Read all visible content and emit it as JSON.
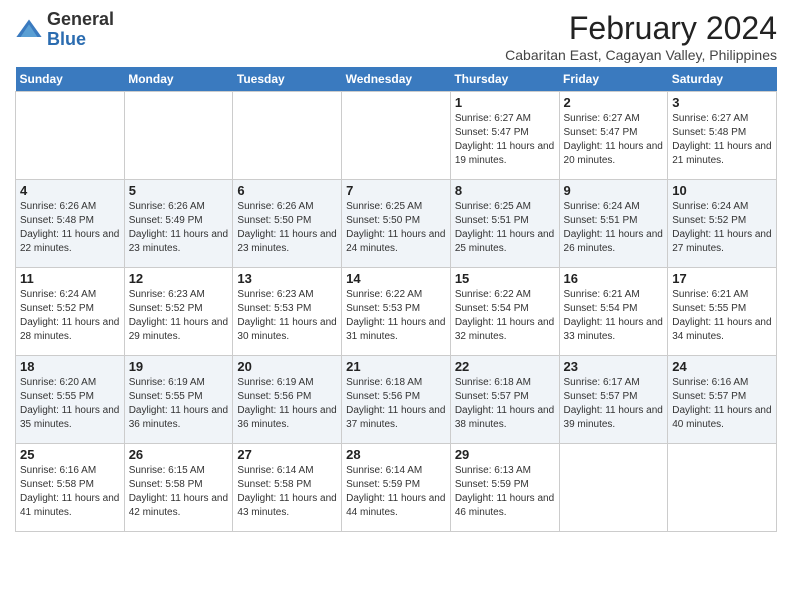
{
  "header": {
    "logo_general": "General",
    "logo_blue": "Blue",
    "month_title": "February 2024",
    "subtitle": "Cabaritan East, Cagayan Valley, Philippines"
  },
  "days_of_week": [
    "Sunday",
    "Monday",
    "Tuesday",
    "Wednesday",
    "Thursday",
    "Friday",
    "Saturday"
  ],
  "weeks": [
    [
      {
        "day": "",
        "info": ""
      },
      {
        "day": "",
        "info": ""
      },
      {
        "day": "",
        "info": ""
      },
      {
        "day": "",
        "info": ""
      },
      {
        "day": "1",
        "info": "Sunrise: 6:27 AM\nSunset: 5:47 PM\nDaylight: 11 hours and 19 minutes."
      },
      {
        "day": "2",
        "info": "Sunrise: 6:27 AM\nSunset: 5:47 PM\nDaylight: 11 hours and 20 minutes."
      },
      {
        "day": "3",
        "info": "Sunrise: 6:27 AM\nSunset: 5:48 PM\nDaylight: 11 hours and 21 minutes."
      }
    ],
    [
      {
        "day": "4",
        "info": "Sunrise: 6:26 AM\nSunset: 5:48 PM\nDaylight: 11 hours and 22 minutes."
      },
      {
        "day": "5",
        "info": "Sunrise: 6:26 AM\nSunset: 5:49 PM\nDaylight: 11 hours and 23 minutes."
      },
      {
        "day": "6",
        "info": "Sunrise: 6:26 AM\nSunset: 5:50 PM\nDaylight: 11 hours and 23 minutes."
      },
      {
        "day": "7",
        "info": "Sunrise: 6:25 AM\nSunset: 5:50 PM\nDaylight: 11 hours and 24 minutes."
      },
      {
        "day": "8",
        "info": "Sunrise: 6:25 AM\nSunset: 5:51 PM\nDaylight: 11 hours and 25 minutes."
      },
      {
        "day": "9",
        "info": "Sunrise: 6:24 AM\nSunset: 5:51 PM\nDaylight: 11 hours and 26 minutes."
      },
      {
        "day": "10",
        "info": "Sunrise: 6:24 AM\nSunset: 5:52 PM\nDaylight: 11 hours and 27 minutes."
      }
    ],
    [
      {
        "day": "11",
        "info": "Sunrise: 6:24 AM\nSunset: 5:52 PM\nDaylight: 11 hours and 28 minutes."
      },
      {
        "day": "12",
        "info": "Sunrise: 6:23 AM\nSunset: 5:52 PM\nDaylight: 11 hours and 29 minutes."
      },
      {
        "day": "13",
        "info": "Sunrise: 6:23 AM\nSunset: 5:53 PM\nDaylight: 11 hours and 30 minutes."
      },
      {
        "day": "14",
        "info": "Sunrise: 6:22 AM\nSunset: 5:53 PM\nDaylight: 11 hours and 31 minutes."
      },
      {
        "day": "15",
        "info": "Sunrise: 6:22 AM\nSunset: 5:54 PM\nDaylight: 11 hours and 32 minutes."
      },
      {
        "day": "16",
        "info": "Sunrise: 6:21 AM\nSunset: 5:54 PM\nDaylight: 11 hours and 33 minutes."
      },
      {
        "day": "17",
        "info": "Sunrise: 6:21 AM\nSunset: 5:55 PM\nDaylight: 11 hours and 34 minutes."
      }
    ],
    [
      {
        "day": "18",
        "info": "Sunrise: 6:20 AM\nSunset: 5:55 PM\nDaylight: 11 hours and 35 minutes."
      },
      {
        "day": "19",
        "info": "Sunrise: 6:19 AM\nSunset: 5:55 PM\nDaylight: 11 hours and 36 minutes."
      },
      {
        "day": "20",
        "info": "Sunrise: 6:19 AM\nSunset: 5:56 PM\nDaylight: 11 hours and 36 minutes."
      },
      {
        "day": "21",
        "info": "Sunrise: 6:18 AM\nSunset: 5:56 PM\nDaylight: 11 hours and 37 minutes."
      },
      {
        "day": "22",
        "info": "Sunrise: 6:18 AM\nSunset: 5:57 PM\nDaylight: 11 hours and 38 minutes."
      },
      {
        "day": "23",
        "info": "Sunrise: 6:17 AM\nSunset: 5:57 PM\nDaylight: 11 hours and 39 minutes."
      },
      {
        "day": "24",
        "info": "Sunrise: 6:16 AM\nSunset: 5:57 PM\nDaylight: 11 hours and 40 minutes."
      }
    ],
    [
      {
        "day": "25",
        "info": "Sunrise: 6:16 AM\nSunset: 5:58 PM\nDaylight: 11 hours and 41 minutes."
      },
      {
        "day": "26",
        "info": "Sunrise: 6:15 AM\nSunset: 5:58 PM\nDaylight: 11 hours and 42 minutes."
      },
      {
        "day": "27",
        "info": "Sunrise: 6:14 AM\nSunset: 5:58 PM\nDaylight: 11 hours and 43 minutes."
      },
      {
        "day": "28",
        "info": "Sunrise: 6:14 AM\nSunset: 5:59 PM\nDaylight: 11 hours and 44 minutes."
      },
      {
        "day": "29",
        "info": "Sunrise: 6:13 AM\nSunset: 5:59 PM\nDaylight: 11 hours and 46 minutes."
      },
      {
        "day": "",
        "info": ""
      },
      {
        "day": "",
        "info": ""
      }
    ]
  ]
}
